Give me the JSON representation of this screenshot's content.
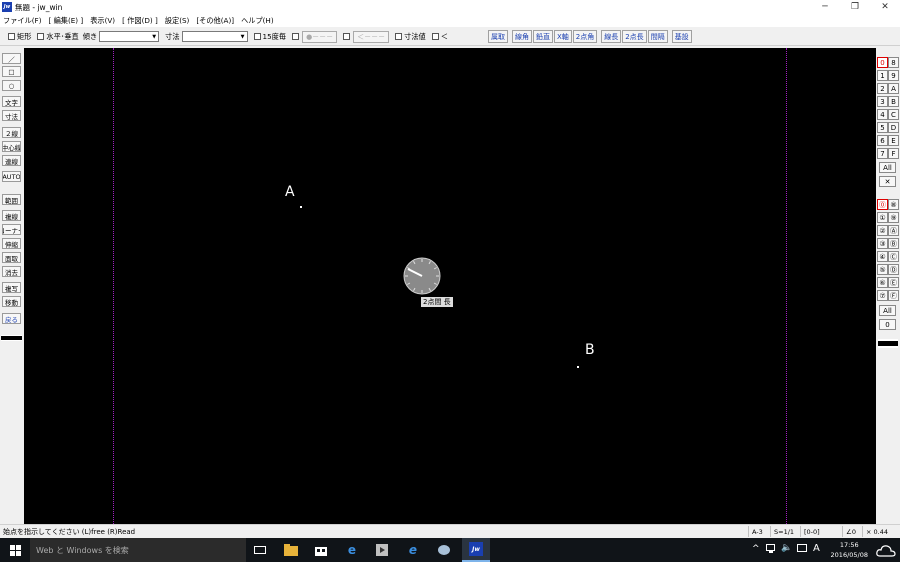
{
  "window": {
    "title": "無題 - jw_win",
    "app_icon": "Jw",
    "controls": [
      "─",
      "❐",
      "✕"
    ]
  },
  "menu": [
    "ファイル(F)",
    "[ 編集(E) ]",
    "表示(V)",
    "[ 作図(D) ]",
    "設定(S)",
    "[その他(A)]",
    "ヘルプ(H)"
  ],
  "toolbar": {
    "rect_label": "矩形",
    "hv_label": "水平･垂直",
    "slope_label": "傾き",
    "dim_label": "寸法",
    "deg15_label": "15度毎",
    "dot_btn": "●－－－",
    "arrow_btn": "＜－－－",
    "dimval_label": "寸法値",
    "lt_label": "＜",
    "right_buttons": [
      "属取",
      "線角",
      "鉛直",
      "X軸",
      "2点角",
      "線長",
      "2点長",
      "間隔",
      "基設"
    ]
  },
  "left_tools": [
    "／",
    "□",
    "○",
    "文字",
    "寸法",
    "２線",
    "中心線",
    "連線",
    "AUTO",
    "範囲",
    "複線",
    "コーナー",
    "伸縮",
    "面取",
    "消去",
    "複写",
    "移動",
    "戻る"
  ],
  "canvas": {
    "point_a": "A",
    "point_b": "B",
    "clock_label": "2点間 長",
    "guide_color": "#a020c0"
  },
  "layer_groups": {
    "layers": [
      [
        "0",
        "8"
      ],
      [
        "1",
        "9"
      ],
      [
        "2",
        "A"
      ],
      [
        "3",
        "B"
      ],
      [
        "4",
        "C"
      ],
      [
        "5",
        "D"
      ],
      [
        "6",
        "E"
      ],
      [
        "7",
        "F"
      ]
    ],
    "all_label": "All",
    "x_label": "✕",
    "group_layers": [
      [
        "⓪",
        "⑧"
      ],
      [
        "①",
        "⑨"
      ],
      [
        "②",
        "Ⓐ"
      ],
      [
        "③",
        "Ⓑ"
      ],
      [
        "④",
        "Ⓒ"
      ],
      [
        "⑤",
        "Ⓓ"
      ],
      [
        "⑥",
        "Ⓔ"
      ],
      [
        "⑦",
        "Ⓕ"
      ]
    ],
    "zero_label": "0"
  },
  "status": {
    "message": "始点を指示してください (L)free (R)Read",
    "paper": "A-3",
    "scale": "S=1/1",
    "layer": "[0-0]",
    "angle": "∠0",
    "zoom": "× 0.44"
  },
  "taskbar": {
    "search_placeholder": "Web と Windows を検索",
    "time": "17:56",
    "date": "2016/05/08",
    "ime": "A"
  }
}
